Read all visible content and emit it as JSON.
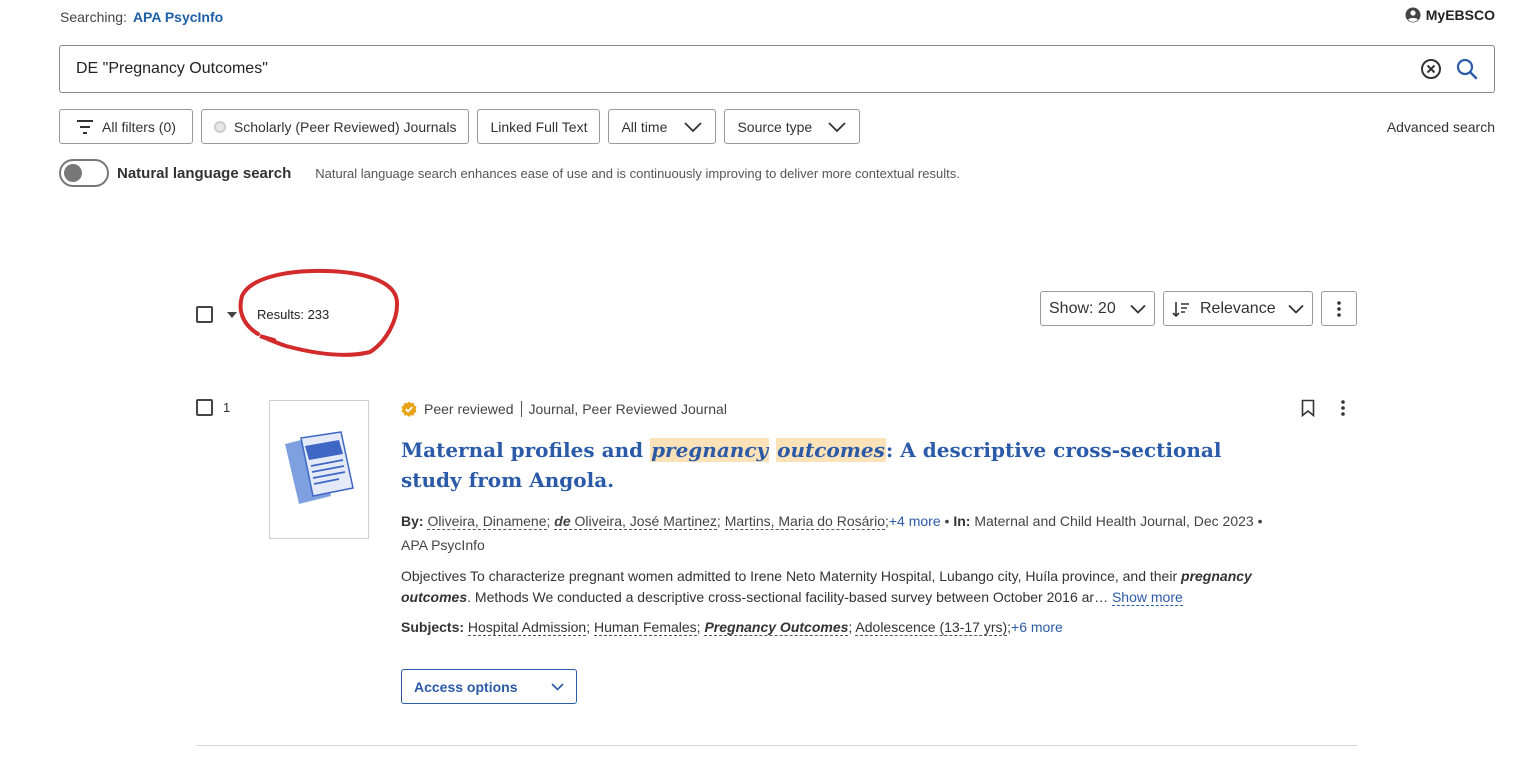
{
  "header": {
    "searching_label": "Searching:",
    "database": "APA PsycInfo",
    "account_label": "MyEBSCO"
  },
  "search": {
    "query": "DE \"Pregnancy Outcomes\""
  },
  "filters": {
    "all_filters": "All filters (0)",
    "scholarly": "Scholarly (Peer Reviewed) Journals",
    "linked_full_text": "Linked Full Text",
    "date": "All time",
    "source_type": "Source type",
    "advanced_search": "Advanced search"
  },
  "natural_language": {
    "label": "Natural language search",
    "description": "Natural language search enhances ease of use and is continuously improving to deliver more contextual results.",
    "enabled": false
  },
  "results": {
    "count_label": "Results: 233",
    "show": "Show: 20",
    "sort": "Relevance"
  },
  "result_items": [
    {
      "index": "1",
      "peer_reviewed": "Peer reviewed",
      "type": "Journal, Peer Reviewed Journal",
      "title_parts": {
        "a": "Maternal profiles and ",
        "hl1": "pregnancy",
        "space": " ",
        "hl2": "outcomes",
        "b": ": A descriptive cross-sectional study from Angola."
      },
      "by_label": "By:",
      "authors": {
        "a1": "Oliveira, Dinamene",
        "a2_prefix": "de",
        "a2": " Oliveira, José Martinez",
        "a3": "Martins, Maria do Rosário"
      },
      "more_authors": "+4 more",
      "in_label": "In:",
      "source": "Maternal and Child Health Journal, Dec 2023",
      "database": "APA PsycInfo",
      "abstract": {
        "a": "Objectives To characterize pregnant women admitted to Irene Neto Maternity Hospital, Lubango city, Huíla province, and their ",
        "em": "pregnancy outcomes",
        "b": ". Methods We conducted a descriptive cross-sectional facility-based survey between October 2016 ar…",
        "show_more": "Show more"
      },
      "subjects_label": "Subjects:",
      "subjects": {
        "s1": "Hospital Admission",
        "s2": "Human Females",
        "s3": "Pregnancy Outcomes",
        "s4": "Adolescence (13-17 yrs)"
      },
      "more_subjects": "+6 more",
      "access_options": "Access options"
    }
  ],
  "colors": {
    "link": "#2a5aa8",
    "highlight": "#fbe2b8",
    "annotation": "#d32b2b",
    "peer_badge": "#e8a317"
  },
  "icons": [
    "user-circle-icon",
    "clear-icon",
    "search-icon",
    "filter-icon",
    "chevron-down-icon",
    "sort-icon",
    "kebab-icon",
    "bookmark-icon",
    "peer-reviewed-badge-icon",
    "document-thumbnail-icon"
  ]
}
